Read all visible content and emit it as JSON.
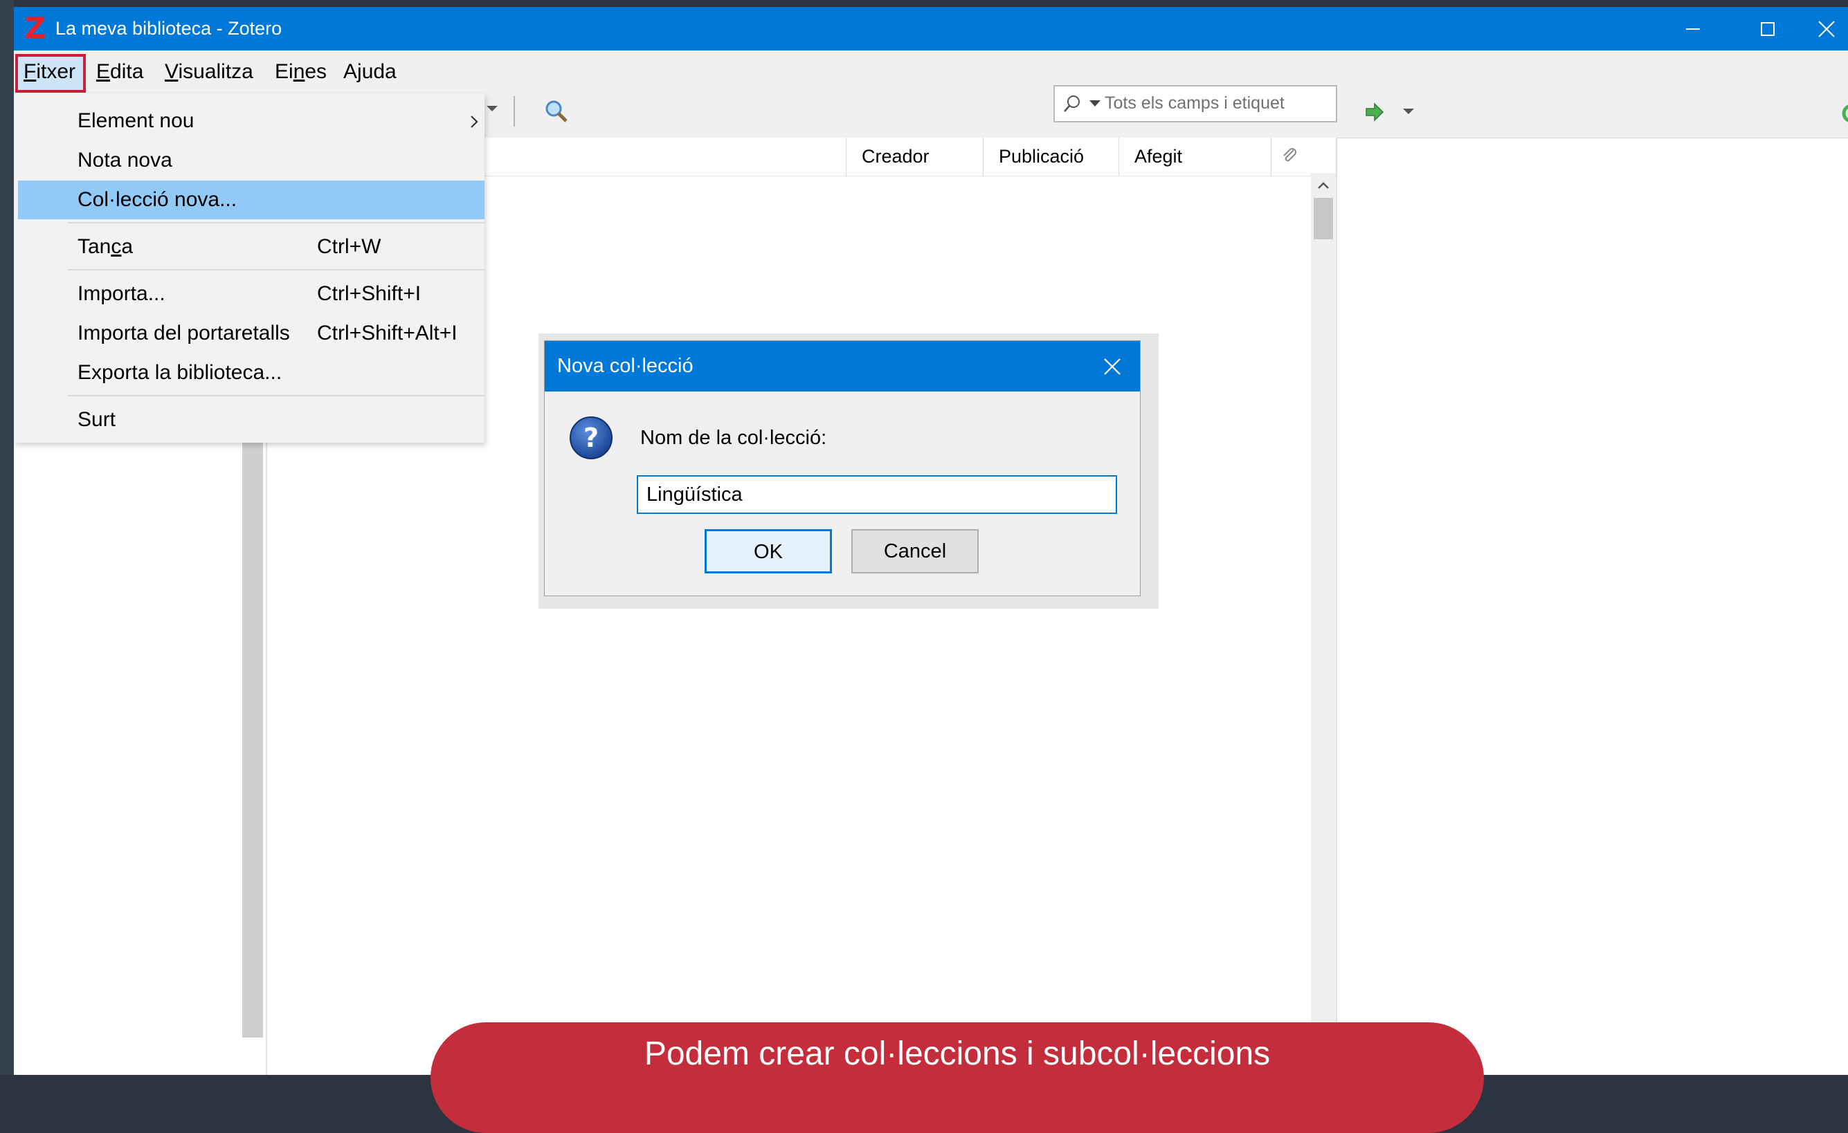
{
  "window": {
    "title": "La meva biblioteca - Zotero",
    "logo_letter": "Z",
    "controls": [
      "minimize",
      "maximize",
      "close"
    ]
  },
  "menubar": {
    "items": [
      {
        "label": "Fitxer",
        "underline": "F",
        "rest": "itxer",
        "selected": true
      },
      {
        "label": "Edita",
        "underline": "E",
        "rest": "dita"
      },
      {
        "label": "Visualitza",
        "underline": "V",
        "rest": "isualitza"
      },
      {
        "label": "Eines",
        "prefix": "Ei",
        "underline": "n",
        "rest": "es"
      },
      {
        "label": "Ajuda",
        "prefix": "A",
        "underline": "j",
        "rest": "uda"
      }
    ]
  },
  "file_menu": {
    "items": [
      {
        "label": "Element nou",
        "shortcut": "",
        "submenu": true
      },
      {
        "label": "Nota nova",
        "shortcut": ""
      },
      {
        "label": "Col·lecció nova...",
        "shortcut": "",
        "highlighted": true
      },
      {
        "label": "Tanca",
        "prefix": "Tan",
        "underline": "c",
        "rest": "a",
        "shortcut": "Ctrl+W"
      },
      {
        "label": "Importa...",
        "shortcut": "Ctrl+Shift+I"
      },
      {
        "label": "Importa del portaretalls",
        "shortcut": "Ctrl+Shift+Alt+I"
      },
      {
        "label": "Exporta la biblioteca...",
        "shortcut": ""
      },
      {
        "label": "Surt",
        "shortcut": ""
      }
    ]
  },
  "toolbar": {
    "search_placeholder": "Tots els camps i etiquet",
    "locate_icon": "green-arrow-icon"
  },
  "columns": [
    "Creador",
    "Publicació",
    "Afegit"
  ],
  "dialog": {
    "title": "Nova col·lecció",
    "prompt": "Nom de la col·lecció:",
    "input_value": "Lingüística",
    "ok_label": "OK",
    "cancel_label": "Cancel"
  },
  "banner": {
    "text": "Podem crear col·leccions i subcol·leccions"
  },
  "colors": {
    "titlebar": "#0078d7",
    "highlight": "#91c9f7",
    "banner": "#c42d3b",
    "fitxer_outline": "#c8203a"
  }
}
